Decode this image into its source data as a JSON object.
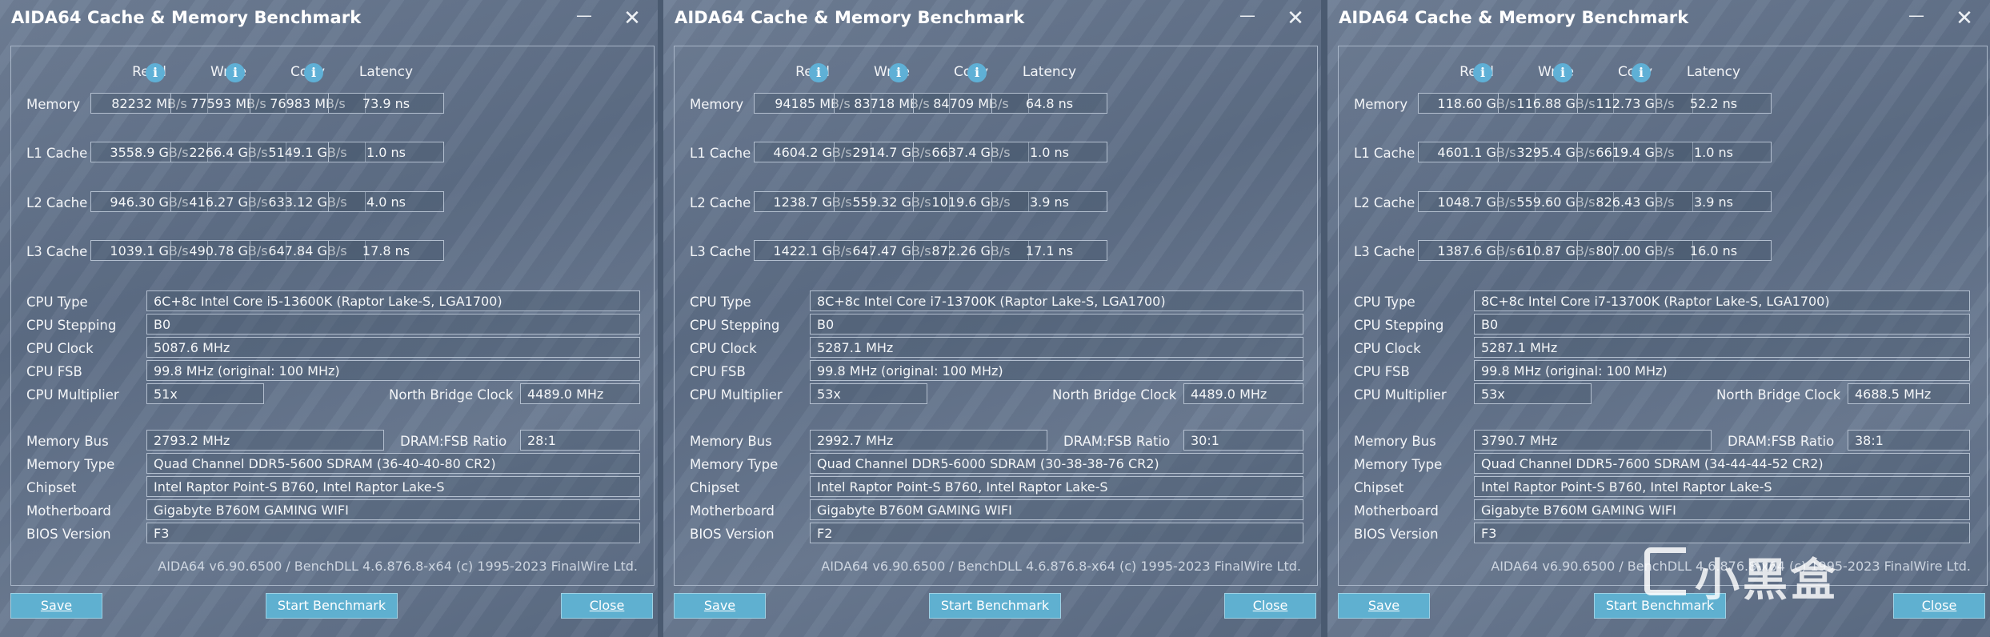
{
  "windows": [
    {
      "title": "AIDA64 Cache & Memory Benchmark",
      "headers": {
        "read": "Read",
        "write": "Write",
        "copy": "Copy",
        "latency": "Latency"
      },
      "rows": [
        {
          "label": "Memory",
          "read": "82232 MB/s",
          "write": "77593 MB/s",
          "copy": "76983 MB/s",
          "latency": "73.9 ns"
        },
        {
          "label": "L1 Cache",
          "read": "3558.9 GB/s",
          "write": "2266.4 GB/s",
          "copy": "5149.1 GB/s",
          "latency": "1.0 ns"
        },
        {
          "label": "L2 Cache",
          "read": "946.30 GB/s",
          "write": "416.27 GB/s",
          "copy": "633.12 GB/s",
          "latency": "4.0 ns"
        },
        {
          "label": "L3 Cache",
          "read": "1039.1 GB/s",
          "write": "490.78 GB/s",
          "copy": "647.84 GB/s",
          "latency": "17.8 ns"
        }
      ],
      "info": {
        "cpu_type_label": "CPU Type",
        "cpu_type": "6C+8c Intel Core i5-13600K  (Raptor Lake-S, LGA1700)",
        "cpu_stepping_label": "CPU Stepping",
        "cpu_stepping": "B0",
        "cpu_clock_label": "CPU Clock",
        "cpu_clock": "5087.6 MHz",
        "cpu_fsb_label": "CPU FSB",
        "cpu_fsb": "99.8 MHz  (original: 100 MHz)",
        "cpu_mult_label": "CPU Multiplier",
        "cpu_mult": "51x",
        "nb_clock_label": "North Bridge Clock",
        "nb_clock": "4489.0 MHz",
        "mem_bus_label": "Memory Bus",
        "mem_bus": "2793.2 MHz",
        "dram_ratio_label": "DRAM:FSB Ratio",
        "dram_ratio": "28:1",
        "mem_type_label": "Memory Type",
        "mem_type": "Quad Channel DDR5-5600 SDRAM  (36-40-40-80 CR2)",
        "chipset_label": "Chipset",
        "chipset": "Intel Raptor Point-S B760, Intel Raptor Lake-S",
        "mobo_label": "Motherboard",
        "mobo": "Gigabyte B760M GAMING WIFI",
        "bios_label": "BIOS Version",
        "bios": "F3"
      },
      "footer": "AIDA64 v6.90.6500 / BenchDLL 4.6.876.8-x64  (c) 1995-2023 FinalWire Ltd.",
      "buttons": {
        "save": "Save",
        "start": "Start Benchmark",
        "close": "Close"
      }
    },
    {
      "title": "AIDA64 Cache & Memory Benchmark",
      "headers": {
        "read": "Read",
        "write": "Write",
        "copy": "Copy",
        "latency": "Latency"
      },
      "rows": [
        {
          "label": "Memory",
          "read": "94185 MB/s",
          "write": "83718 MB/s",
          "copy": "84709 MB/s",
          "latency": "64.8 ns"
        },
        {
          "label": "L1 Cache",
          "read": "4604.2 GB/s",
          "write": "2914.7 GB/s",
          "copy": "6637.4 GB/s",
          "latency": "1.0 ns"
        },
        {
          "label": "L2 Cache",
          "read": "1238.7 GB/s",
          "write": "559.32 GB/s",
          "copy": "1019.6 GB/s",
          "latency": "3.9 ns"
        },
        {
          "label": "L3 Cache",
          "read": "1422.1 GB/s",
          "write": "647.47 GB/s",
          "copy": "872.26 GB/s",
          "latency": "17.1 ns"
        }
      ],
      "info": {
        "cpu_type_label": "CPU Type",
        "cpu_type": "8C+8c Intel Core i7-13700K  (Raptor Lake-S, LGA1700)",
        "cpu_stepping_label": "CPU Stepping",
        "cpu_stepping": "B0",
        "cpu_clock_label": "CPU Clock",
        "cpu_clock": "5287.1 MHz",
        "cpu_fsb_label": "CPU FSB",
        "cpu_fsb": "99.8 MHz  (original: 100 MHz)",
        "cpu_mult_label": "CPU Multiplier",
        "cpu_mult": "53x",
        "nb_clock_label": "North Bridge Clock",
        "nb_clock": "4489.0 MHz",
        "mem_bus_label": "Memory Bus",
        "mem_bus": "2992.7 MHz",
        "dram_ratio_label": "DRAM:FSB Ratio",
        "dram_ratio": "30:1",
        "mem_type_label": "Memory Type",
        "mem_type": "Quad Channel DDR5-6000 SDRAM  (30-38-38-76 CR2)",
        "chipset_label": "Chipset",
        "chipset": "Intel Raptor Point-S B760, Intel Raptor Lake-S",
        "mobo_label": "Motherboard",
        "mobo": "Gigabyte B760M GAMING WIFI",
        "bios_label": "BIOS Version",
        "bios": "F2"
      },
      "footer": "AIDA64 v6.90.6500 / BenchDLL 4.6.876.8-x64  (c) 1995-2023 FinalWire Ltd.",
      "buttons": {
        "save": "Save",
        "start": "Start Benchmark",
        "close": "Close"
      }
    },
    {
      "title": "AIDA64 Cache & Memory Benchmark",
      "headers": {
        "read": "Read",
        "write": "Write",
        "copy": "Copy",
        "latency": "Latency"
      },
      "rows": [
        {
          "label": "Memory",
          "read": "118.60 GB/s",
          "write": "116.88 GB/s",
          "copy": "112.73 GB/s",
          "latency": "52.2 ns"
        },
        {
          "label": "L1 Cache",
          "read": "4601.1 GB/s",
          "write": "3295.4 GB/s",
          "copy": "6619.4 GB/s",
          "latency": "1.0 ns"
        },
        {
          "label": "L2 Cache",
          "read": "1048.7 GB/s",
          "write": "559.60 GB/s",
          "copy": "826.43 GB/s",
          "latency": "3.9 ns"
        },
        {
          "label": "L3 Cache",
          "read": "1387.6 GB/s",
          "write": "610.87 GB/s",
          "copy": "807.00 GB/s",
          "latency": "16.0 ns"
        }
      ],
      "info": {
        "cpu_type_label": "CPU Type",
        "cpu_type": "8C+8c Intel Core i7-13700K  (Raptor Lake-S, LGA1700)",
        "cpu_stepping_label": "CPU Stepping",
        "cpu_stepping": "B0",
        "cpu_clock_label": "CPU Clock",
        "cpu_clock": "5287.1 MHz",
        "cpu_fsb_label": "CPU FSB",
        "cpu_fsb": "99.8 MHz  (original: 100 MHz)",
        "cpu_mult_label": "CPU Multiplier",
        "cpu_mult": "53x",
        "nb_clock_label": "North Bridge Clock",
        "nb_clock": "4688.5 MHz",
        "mem_bus_label": "Memory Bus",
        "mem_bus": "3790.7 MHz",
        "dram_ratio_label": "DRAM:FSB Ratio",
        "dram_ratio": "38:1",
        "mem_type_label": "Memory Type",
        "mem_type": "Quad Channel DDR5-7600 SDRAM  (34-44-44-52 CR2)",
        "chipset_label": "Chipset",
        "chipset": "Intel Raptor Point-S B760, Intel Raptor Lake-S",
        "mobo_label": "Motherboard",
        "mobo": "Gigabyte B760M GAMING WIFI",
        "bios_label": "BIOS Version",
        "bios": "F3"
      },
      "footer": "AIDA64 v6.90.6500 / BenchDLL 4.6.876.8-x64  (c) 1995-2023 FinalWire Ltd.",
      "buttons": {
        "save": "Save",
        "start": "Start Benchmark",
        "close": "Close"
      }
    }
  ],
  "watermark": "小黑盒",
  "icons": {
    "info": "info-icon",
    "minimize": "minimize-icon",
    "close": "close-icon"
  },
  "colors": {
    "button": "#5fb0d0",
    "info_icon": "#5fb0d6",
    "background": "#6a7a91"
  }
}
